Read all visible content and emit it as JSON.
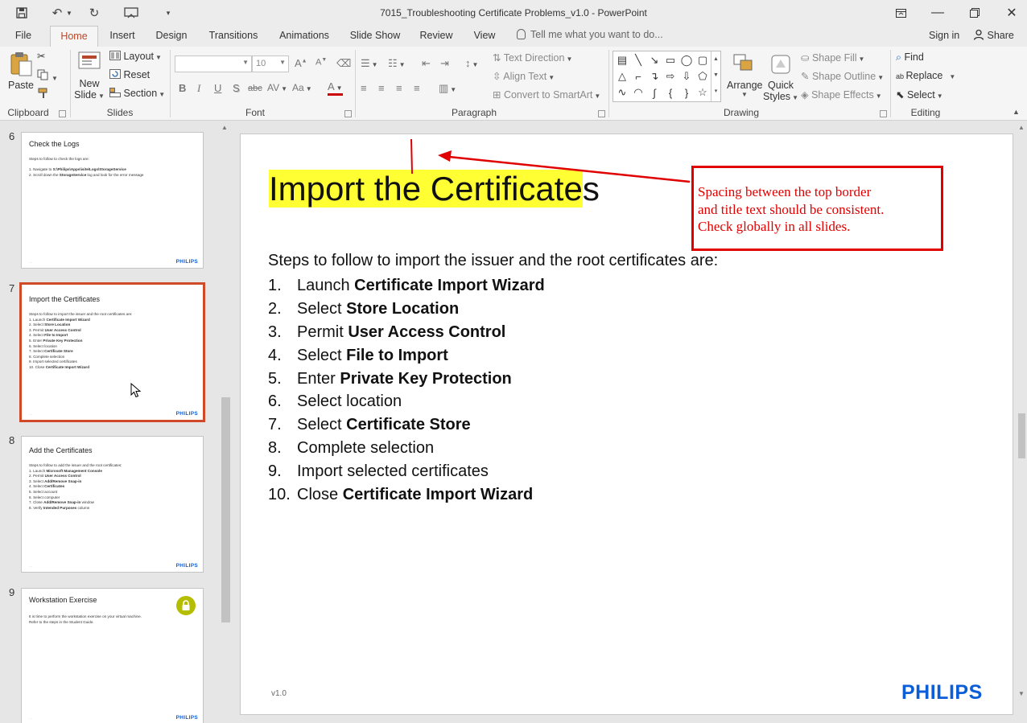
{
  "window": {
    "title": "7015_Troubleshooting Certificate Problems_v1.0 - PowerPoint"
  },
  "tabs": [
    {
      "label": "File"
    },
    {
      "label": "Home"
    },
    {
      "label": "Insert"
    },
    {
      "label": "Design"
    },
    {
      "label": "Transitions"
    },
    {
      "label": "Animations"
    },
    {
      "label": "Slide Show"
    },
    {
      "label": "Review"
    },
    {
      "label": "View"
    }
  ],
  "tell_me": "Tell me what you want to do...",
  "sign_in": "Sign in",
  "share": "Share",
  "ribbon": {
    "clipboard": {
      "paste": "Paste",
      "label": "Clipboard"
    },
    "slides": {
      "new_slide_1": "New",
      "new_slide_2": "Slide",
      "layout": "Layout",
      "reset": "Reset",
      "section": "Section",
      "label": "Slides"
    },
    "font": {
      "size": "10",
      "label": "Font",
      "bold": "B",
      "italic": "I",
      "underline": "U",
      "shadow": "S",
      "strike": "abc",
      "spacing": "AV",
      "case": "Aa",
      "color": "A"
    },
    "paragraph": {
      "text_direction": "Text Direction",
      "align_text": "Align Text",
      "convert_smartart": "Convert to SmartArt",
      "label": "Paragraph"
    },
    "drawing": {
      "arrange": "Arrange",
      "quick_styles_1": "Quick",
      "quick_styles_2": "Styles",
      "shape_fill": "Shape Fill",
      "shape_outline": "Shape Outline",
      "shape_effects": "Shape Effects",
      "label": "Drawing"
    },
    "editing": {
      "find": "Find",
      "replace": "Replace",
      "select": "Select",
      "label": "Editing"
    }
  },
  "thumbnails": [
    {
      "number": "6",
      "title": "Check the Logs",
      "lines": [
        [
          {
            "t": "Steps to follow to check the logs are:"
          }
        ],
        [
          {
            "t": ""
          }
        ],
        [
          {
            "t": "1.  Navigate to "
          },
          {
            "t": "S:\\Philips\\Apps\\isite\\Logs\\StorageService",
            "b": true
          }
        ],
        [
          {
            "t": "2.  Scroll down the "
          },
          {
            "t": "StorageService",
            "b": true
          },
          {
            "t": " log and look for the error message"
          }
        ]
      ],
      "footer": "…",
      "logo": "PHILIPS"
    },
    {
      "number": "7",
      "title": "Import the Certificates",
      "lines": [
        [
          {
            "t": "Steps to follow to import the issuer and the root certificates are:"
          }
        ],
        [
          {
            "t": "1.    Launch "
          },
          {
            "t": "Certificate Import Wizard",
            "b": true
          }
        ],
        [
          {
            "t": "2.    Select "
          },
          {
            "t": "Store Location",
            "b": true
          }
        ],
        [
          {
            "t": "3.    Permit "
          },
          {
            "t": "User Access Control",
            "b": true
          }
        ],
        [
          {
            "t": "4.    Select "
          },
          {
            "t": "File to Import",
            "b": true
          }
        ],
        [
          {
            "t": "5.    Enter "
          },
          {
            "t": "Private Key Protection",
            "b": true
          }
        ],
        [
          {
            "t": "6.    Select location"
          }
        ],
        [
          {
            "t": "7.    Select "
          },
          {
            "t": "Certificate Store",
            "b": true
          }
        ],
        [
          {
            "t": "8.    Complete selection"
          }
        ],
        [
          {
            "t": "9.    Import selected certificates"
          }
        ],
        [
          {
            "t": "10. Close "
          },
          {
            "t": "Certificate Import Wizard",
            "b": true
          }
        ]
      ],
      "footer": "…",
      "logo": "PHILIPS"
    },
    {
      "number": "8",
      "title": "Add the Certificates",
      "lines": [
        [
          {
            "t": "Steps to follow to add the issuer and the root certificates:"
          }
        ],
        [
          {
            "t": "1.    Launch "
          },
          {
            "t": "Microsoft Management Console",
            "b": true
          }
        ],
        [
          {
            "t": "2.    Permit "
          },
          {
            "t": "User Access Control",
            "b": true
          }
        ],
        [
          {
            "t": "3.    Select "
          },
          {
            "t": "Add/Remove Snap-in",
            "b": true
          }
        ],
        [
          {
            "t": "4.    Select "
          },
          {
            "t": "Certificates",
            "b": true
          }
        ],
        [
          {
            "t": "5.    Select account"
          }
        ],
        [
          {
            "t": "6.    Select computer"
          }
        ],
        [
          {
            "t": "7.    Close "
          },
          {
            "t": "Add/Remove Snap-in",
            "b": true
          },
          {
            "t": " window"
          }
        ],
        [
          {
            "t": "8.    Verify "
          },
          {
            "t": "Intended Purposes",
            "b": true
          },
          {
            "t": " column"
          }
        ]
      ],
      "footer": "…",
      "logo": "PHILIPS"
    },
    {
      "number": "9",
      "title": "Workstation Exercise",
      "lines": [
        [
          {
            "t": "It is time to perform the workstation exercise on your virtual machine."
          }
        ],
        [
          {
            "t": "Refer to the steps in the Student Guide."
          }
        ]
      ],
      "footer": "…",
      "logo": "PHILIPS",
      "lock": true
    }
  ],
  "slide": {
    "title_highlighted": "Import the Certificate",
    "title_rest": "s",
    "intro": "Steps to follow to import the issuer and the root certificates are:",
    "steps": [
      {
        "num": "1.",
        "parts": [
          {
            "t": "Launch "
          },
          {
            "t": "Certificate Import Wizard",
            "b": true
          }
        ]
      },
      {
        "num": "2.",
        "parts": [
          {
            "t": "Select "
          },
          {
            "t": "Store Location",
            "b": true
          }
        ]
      },
      {
        "num": "3.",
        "parts": [
          {
            "t": "Permit "
          },
          {
            "t": "User Access Control",
            "b": true
          }
        ]
      },
      {
        "num": "4.",
        "parts": [
          {
            "t": "Select "
          },
          {
            "t": "File to Import",
            "b": true
          }
        ]
      },
      {
        "num": "5.",
        "parts": [
          {
            "t": "Enter "
          },
          {
            "t": "Private Key Protection",
            "b": true
          }
        ]
      },
      {
        "num": "6.",
        "parts": [
          {
            "t": "Select location"
          }
        ]
      },
      {
        "num": "7.",
        "parts": [
          {
            "t": "Select "
          },
          {
            "t": "Certificate Store",
            "b": true
          }
        ]
      },
      {
        "num": "8.",
        "parts": [
          {
            "t": "Complete selection"
          }
        ]
      },
      {
        "num": "9.",
        "parts": [
          {
            "t": "Import selected certificates"
          }
        ]
      },
      {
        "num": "10.",
        "parts": [
          {
            "t": "Close "
          },
          {
            "t": "Certificate Import Wizard",
            "b": true
          }
        ]
      }
    ],
    "version": "v1.0",
    "logo": "PHILIPS",
    "comment_lines": [
      "Spacing between the top border",
      "and title text should be consistent.",
      "Check globally in all slides."
    ]
  },
  "colors": {
    "accent": "#b7472a",
    "selected_thumb": "#d04a2a",
    "highlight": "#ffff33",
    "comment": "#e00000",
    "philips_blue": "#0b5ed7",
    "lock_badge": "#b5bd00"
  }
}
